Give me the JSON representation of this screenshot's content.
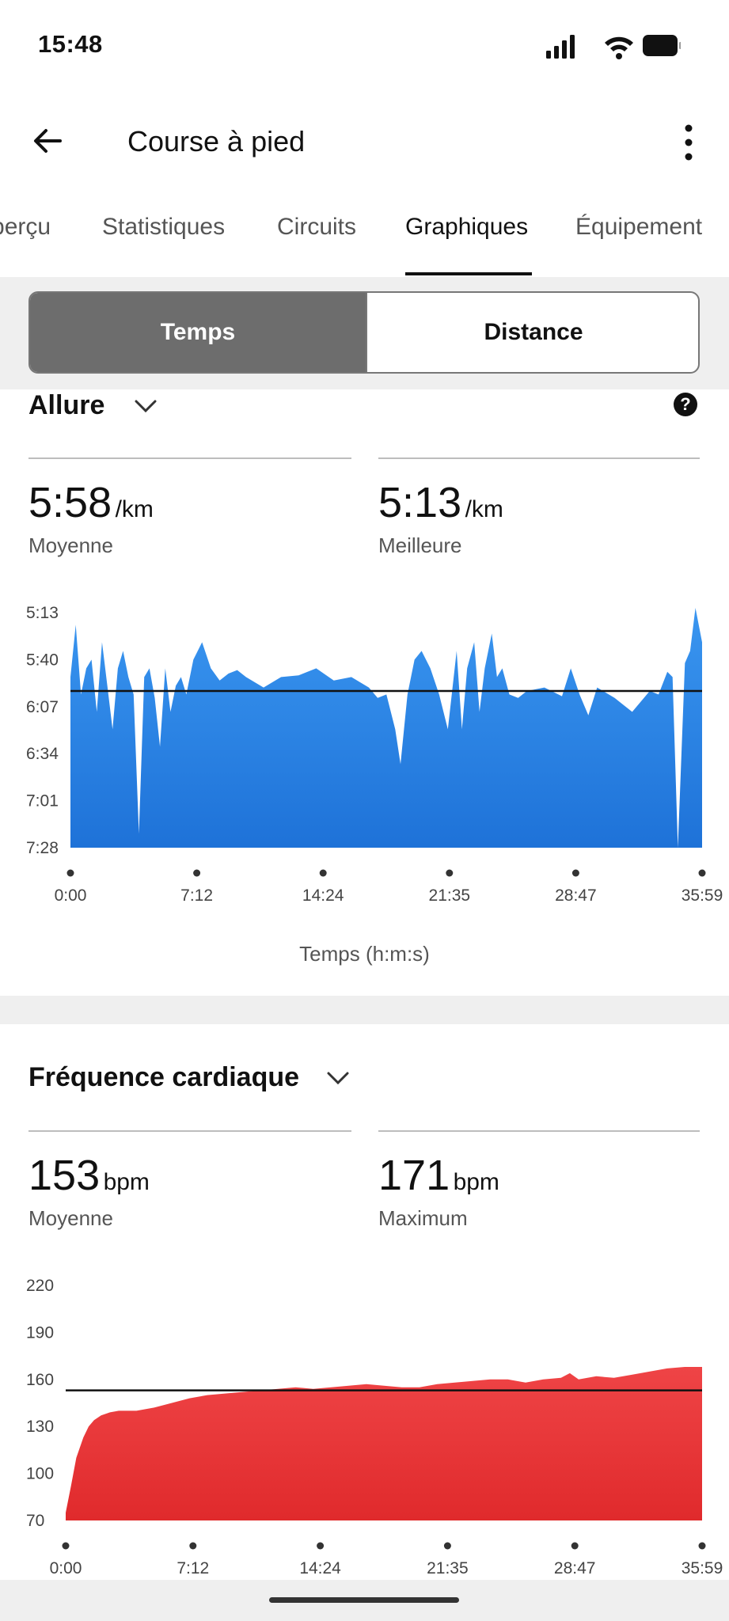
{
  "status_bar": {
    "time": "15:48"
  },
  "header": {
    "title": "Course à pied"
  },
  "tabs": [
    {
      "label": "Aperçu",
      "active": false
    },
    {
      "label": "Statistiques",
      "active": false
    },
    {
      "label": "Circuits",
      "active": false
    },
    {
      "label": "Graphiques",
      "active": true
    },
    {
      "label": "Équipement",
      "active": false
    }
  ],
  "segmented": {
    "left": "Temps",
    "right": "Distance",
    "selected": "Temps"
  },
  "pace": {
    "title": "Allure",
    "help": "?",
    "avg_value": "5:58",
    "avg_unit": "/km",
    "avg_label": "Moyenne",
    "best_value": "5:13",
    "best_unit": "/km",
    "best_label": "Meilleure",
    "xlabel": "Temps (h:m:s)"
  },
  "hr": {
    "title": "Fréquence cardiaque",
    "avg_value": "153",
    "avg_unit": "bpm",
    "avg_label": "Moyenne",
    "max_value": "171",
    "max_unit": "bpm",
    "max_label": "Maximum"
  },
  "colors": {
    "pace_fill": "#2f88e6",
    "hr_fill": "#e8383a",
    "active_segment": "#6d6d6d"
  },
  "chart_data": [
    {
      "type": "area",
      "series_name": "Allure",
      "x_ticks": [
        "0:00",
        "7:12",
        "14:24",
        "21:35",
        "28:47",
        "35:59"
      ],
      "y_ticks": [
        "5:13",
        "5:40",
        "6:07",
        "6:34",
        "7:01",
        "7:28"
      ],
      "y_inverted": true,
      "y_unit": "min/km",
      "ylim_seconds": [
        313,
        448
      ],
      "xlim_minutes": [
        0,
        35.98
      ],
      "average_line_seconds": 358,
      "x": [
        0,
        0.3,
        0.6,
        0.9,
        1.2,
        1.5,
        1.8,
        2.1,
        2.4,
        2.7,
        3.0,
        3.3,
        3.6,
        3.9,
        4.2,
        4.5,
        4.8,
        5.1,
        5.4,
        5.7,
        6.0,
        6.3,
        6.6,
        7.0,
        7.5,
        8.0,
        8.5,
        9.0,
        9.5,
        10.0,
        11.0,
        12.0,
        13.0,
        14.0,
        15.0,
        16.0,
        17.0,
        17.5,
        18.0,
        18.5,
        18.8,
        19.2,
        19.6,
        20.0,
        20.5,
        21.0,
        21.5,
        22.0,
        22.3,
        22.6,
        23.0,
        23.3,
        23.6,
        24.0,
        24.3,
        24.6,
        25.0,
        25.5,
        26.0,
        27.0,
        28.0,
        28.5,
        29.0,
        29.5,
        30.0,
        31.0,
        32.0,
        33.0,
        33.5,
        34.0,
        34.3,
        34.6,
        35.0,
        35.3,
        35.6,
        35.98
      ],
      "y": [
        350,
        320,
        360,
        345,
        340,
        370,
        330,
        355,
        380,
        345,
        335,
        350,
        360,
        440,
        350,
        345,
        362,
        390,
        345,
        370,
        355,
        350,
        360,
        340,
        330,
        345,
        352,
        348,
        346,
        350,
        356,
        350,
        349,
        345,
        352,
        350,
        356,
        362,
        360,
        380,
        400,
        360,
        340,
        335,
        345,
        360,
        380,
        335,
        380,
        345,
        330,
        370,
        345,
        325,
        350,
        345,
        360,
        362,
        358,
        356,
        361,
        345,
        360,
        372,
        356,
        362,
        370,
        358,
        360,
        347,
        350,
        448,
        342,
        335,
        305,
        330
      ],
      "note_y": "pace in seconds per km"
    },
    {
      "type": "area",
      "series_name": "Fréquence cardiaque",
      "x_ticks": [
        "0:00",
        "7:12",
        "14:24",
        "21:35",
        "28:47",
        "35:59"
      ],
      "y_ticks": [
        220,
        190,
        160,
        130,
        100,
        70
      ],
      "ylim": [
        70,
        220
      ],
      "xlim_minutes": [
        0,
        35.98
      ],
      "average_line": 153,
      "x": [
        0,
        0.3,
        0.6,
        1.0,
        1.3,
        1.6,
        2.0,
        2.5,
        3.0,
        3.5,
        4.0,
        5.0,
        6.0,
        7.0,
        8.0,
        9.0,
        10.0,
        11.0,
        12.0,
        13.0,
        14.0,
        15.0,
        16.0,
        17.0,
        18.0,
        19.0,
        20.0,
        20.5,
        21.0,
        22.0,
        23.0,
        24.0,
        25.0,
        26.0,
        27.0,
        28.0,
        28.5,
        29.0,
        30.0,
        31.0,
        32.0,
        33.0,
        34.0,
        35.0,
        35.98
      ],
      "y": [
        75,
        92,
        110,
        123,
        130,
        134,
        137,
        139,
        140,
        140,
        140,
        142,
        145,
        148,
        150,
        151,
        152,
        153,
        154,
        155,
        154,
        155,
        156,
        157,
        156,
        155,
        155,
        156,
        157,
        158,
        159,
        160,
        160,
        158,
        160,
        161,
        164,
        160,
        162,
        161,
        163,
        165,
        167,
        168,
        168
      ]
    }
  ]
}
